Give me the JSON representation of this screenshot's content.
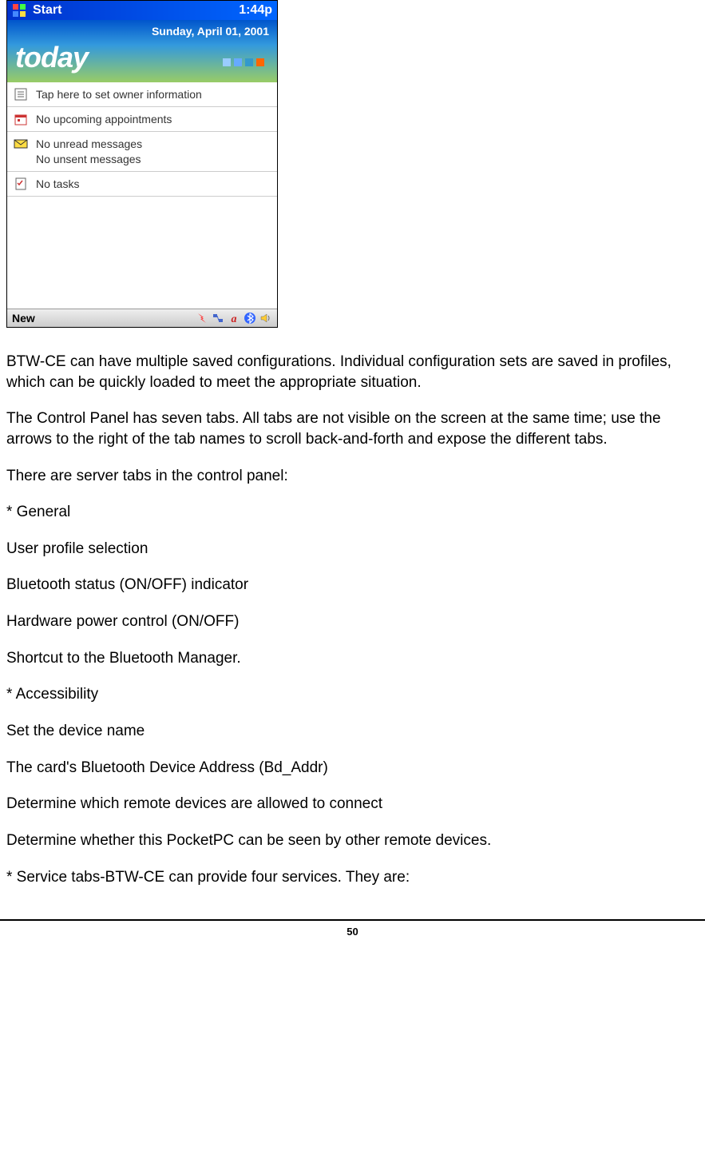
{
  "pocketpc": {
    "titlebar": {
      "title": "Start",
      "time": "1:44p"
    },
    "header": {
      "date": "Sunday, April 01, 2001",
      "today": "today"
    },
    "items": {
      "owner": "Tap here to set owner information",
      "appointments": "No upcoming appointments",
      "messages_unread": "No unread messages",
      "messages_unsent": "No unsent messages",
      "tasks": "No tasks"
    },
    "bottombar": {
      "new": "New"
    }
  },
  "doc": {
    "p1": "BTW-CE can have multiple saved configurations. Individual configuration sets are saved in profiles, which can be quickly loaded to meet the appropriate situation.",
    "p2": "The Control Panel has seven tabs. All tabs are not visible on the screen at the same time; use the arrows to the right of the tab names to scroll back-and-forth and expose the different tabs.",
    "p3": "There are server tabs in the control panel:",
    "p4": "* General",
    "p5": "User profile selection",
    "p6": "Bluetooth status (ON/OFF) indicator",
    "p7": "Hardware power control (ON/OFF)",
    "p8": "Shortcut to the Bluetooth Manager.",
    "p9": "* Accessibility",
    "p10": "Set the device name",
    "p11": "The card's Bluetooth Device Address (Bd_Addr)",
    "p12": "Determine which remote devices are allowed to connect",
    "p13": "Determine whether this PocketPC can be seen by other remote devices.",
    "p14": "* Service tabs-BTW-CE can provide four services. They are:"
  },
  "page_number": "50"
}
